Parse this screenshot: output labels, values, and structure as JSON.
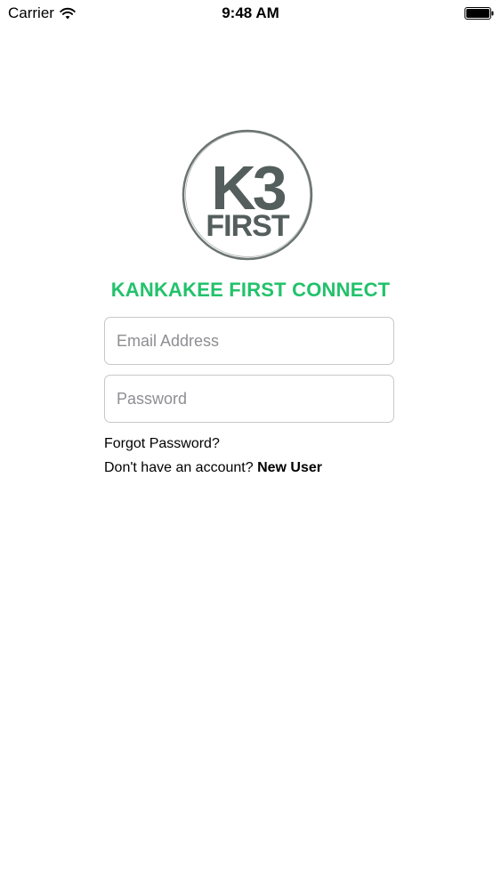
{
  "status_bar": {
    "carrier": "Carrier",
    "time": "9:48 AM",
    "wifi_icon": "wifi-icon",
    "battery_icon": "battery-icon"
  },
  "logo": {
    "line1": "K3",
    "line2": "FIRST",
    "text_color": "#545e5c",
    "ring_color": "#6b7472"
  },
  "app_title": "KANKAKEE FIRST CONNECT",
  "login_form": {
    "email": {
      "placeholder": "Email Address",
      "value": ""
    },
    "password": {
      "placeholder": "Password",
      "value": ""
    },
    "forgot_password": "Forgot Password?",
    "signup_prompt": "Don't have an account?",
    "new_user": "New User"
  },
  "colors": {
    "accent": "#22c26b",
    "field_border": "#c8c8cc",
    "placeholder": "#8e8e93"
  }
}
